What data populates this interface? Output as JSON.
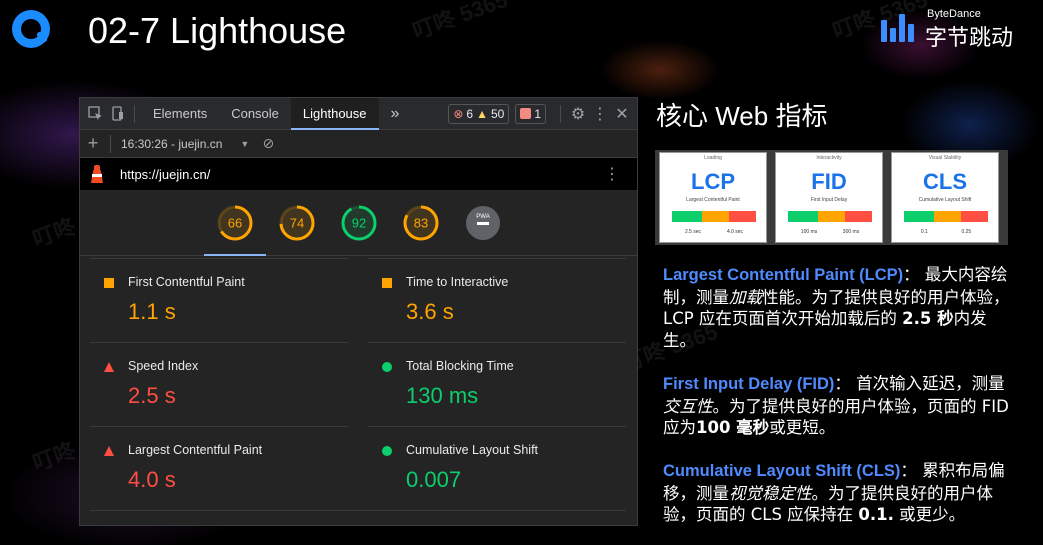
{
  "slide": {
    "title": "02-7 Lighthouse",
    "brand_en": "ByteDance",
    "brand_cn": "字节跳动",
    "watermark": "叮咚 5365"
  },
  "devtools": {
    "tabs": [
      "Elements",
      "Console",
      "Lighthouse"
    ],
    "more": "»",
    "errors": "6",
    "warnings": "50",
    "issues": "1",
    "report_select": "16:30:26 - juejin.cn",
    "url": "https://juejin.cn/",
    "gauges": [
      {
        "score": 66,
        "color": "#ffa400"
      },
      {
        "score": 74,
        "color": "#ffa400"
      },
      {
        "score": 92,
        "color": "#0cce6b"
      },
      {
        "score": 83,
        "color": "#ffa400"
      },
      {
        "score": "PWA",
        "color": "#9e9e9e"
      }
    ],
    "metrics": [
      {
        "label": "First Contentful Paint",
        "value": "1.1 s",
        "status": "average"
      },
      {
        "label": "Time to Interactive",
        "value": "3.6 s",
        "status": "average"
      },
      {
        "label": "Speed Index",
        "value": "2.5 s",
        "status": "fail"
      },
      {
        "label": "Total Blocking Time",
        "value": "130 ms",
        "status": "pass"
      },
      {
        "label": "Largest Contentful Paint",
        "value": "4.0 s",
        "status": "fail"
      },
      {
        "label": "Cumulative Layout Shift",
        "value": "0.007",
        "status": "pass"
      }
    ]
  },
  "right": {
    "heading": "核心 Web 指标",
    "cards": [
      {
        "caption": "Loading",
        "name": "LCP",
        "sub": "Largest Contentful Paint",
        "ticks": [
          "2.5 sec",
          "4.0 sec"
        ]
      },
      {
        "caption": "Interactivity",
        "name": "FID",
        "sub": "First Input Delay",
        "ticks": [
          "100 ms",
          "300 ms"
        ]
      },
      {
        "caption": "Visual Stability",
        "name": "CLS",
        "sub": "Cumulative Layout Shift",
        "ticks": [
          "0.1",
          "0.25"
        ]
      }
    ],
    "lcp": {
      "key": "Largest Contentful Paint (LCP)",
      "text1": "： 最大内容绘制，测量",
      "em": "加载",
      "text2": "性能。为了提供良好的用户体验，LCP 应在页面首次开始加载后的 ",
      "strong": "2.5 秒",
      "text3": "内发生。"
    },
    "fid": {
      "key": "First Input Delay (FID)",
      "text1": "： 首次输入延迟，测量",
      "em": "交互性",
      "text2": "。为了提供良好的用户体验，页面的 FID 应为",
      "strong": "100 毫秒",
      "text3": "或更短。"
    },
    "cls": {
      "key": "Cumulative Layout Shift (CLS)",
      "text1": "： 累积布局偏移，测量",
      "em": "视觉稳定性",
      "text2": "。为了提供良好的用户体验，页面的 CLS 应保持在 ",
      "strong": "0.1.",
      "text3": " 或更少。"
    }
  }
}
